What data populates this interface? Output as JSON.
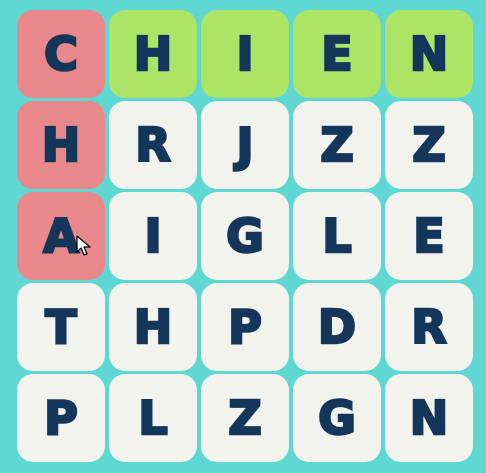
{
  "colors": {
    "background": "#5fd8d4",
    "tile": "#f3f3ee",
    "selected_tile": "#e8888a",
    "found_tile": "#ace466",
    "letter": "#14365a"
  },
  "grid": [
    [
      {
        "letter": "C",
        "state": "selected"
      },
      {
        "letter": "H",
        "state": "found"
      },
      {
        "letter": "I",
        "state": "found"
      },
      {
        "letter": "E",
        "state": "found"
      },
      {
        "letter": "N",
        "state": "found"
      }
    ],
    [
      {
        "letter": "H",
        "state": "selected"
      },
      {
        "letter": "R",
        "state": "normal"
      },
      {
        "letter": "J",
        "state": "normal"
      },
      {
        "letter": "Z",
        "state": "normal"
      },
      {
        "letter": "Z",
        "state": "normal"
      }
    ],
    [
      {
        "letter": "A",
        "state": "selected"
      },
      {
        "letter": "I",
        "state": "normal"
      },
      {
        "letter": "G",
        "state": "normal"
      },
      {
        "letter": "L",
        "state": "normal"
      },
      {
        "letter": "E",
        "state": "normal"
      }
    ],
    [
      {
        "letter": "T",
        "state": "normal"
      },
      {
        "letter": "H",
        "state": "normal"
      },
      {
        "letter": "P",
        "state": "normal"
      },
      {
        "letter": "D",
        "state": "normal"
      },
      {
        "letter": "R",
        "state": "normal"
      }
    ],
    [
      {
        "letter": "P",
        "state": "normal"
      },
      {
        "letter": "L",
        "state": "normal"
      },
      {
        "letter": "Z",
        "state": "normal"
      },
      {
        "letter": "G",
        "state": "normal"
      },
      {
        "letter": "N",
        "state": "normal"
      }
    ]
  ],
  "cursor_icon": "mouse-pointer-icon"
}
